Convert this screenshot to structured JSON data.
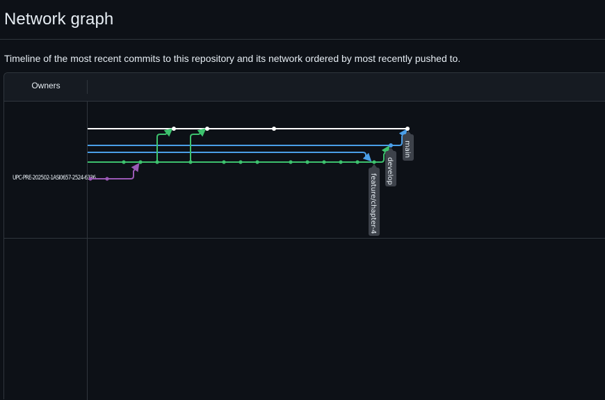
{
  "page": {
    "title": "Network graph",
    "subtitle": "Timeline of the most recent commits to this repository and its network ordered by most recently pushed to."
  },
  "graph": {
    "owners_header": "Owners",
    "owner_name": "UPC-PRE-202502-1ASI0657-2524-6336",
    "branch_labels": {
      "main": "main",
      "develop": "develop",
      "feature": "feature/chapter-4"
    },
    "colors": {
      "main": "#ffffff",
      "develop_a": "#4a9fe8",
      "develop_b": "#4a9fe8",
      "feature": "#3dc26e",
      "fork": "#9b59b6",
      "label_bg": "#3d424a"
    }
  }
}
